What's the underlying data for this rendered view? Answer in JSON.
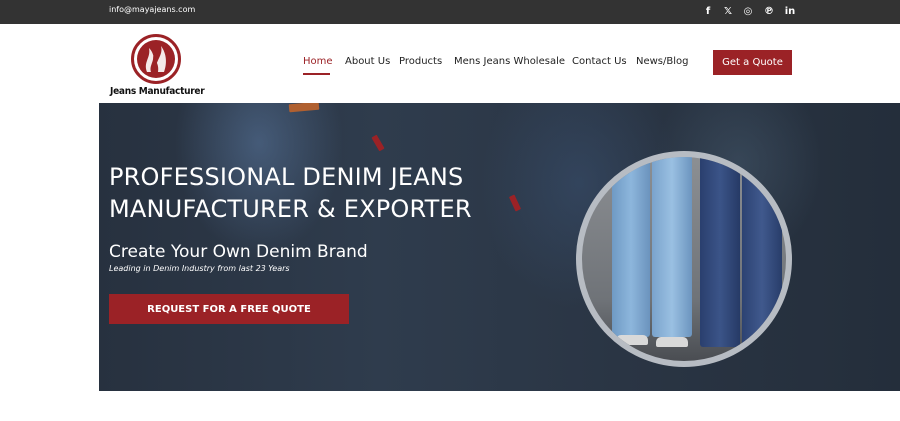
{
  "topbar": {
    "email": "info@mayajeans.com",
    "social": [
      {
        "icon": "facebook-icon",
        "glyph": "f"
      },
      {
        "icon": "x-icon",
        "glyph": "𝕏"
      },
      {
        "icon": "instagram-icon",
        "glyph": "◎"
      },
      {
        "icon": "pinterest-icon",
        "glyph": "℗"
      },
      {
        "icon": "linkedin-icon",
        "glyph": "in"
      }
    ]
  },
  "header": {
    "logo_text": "Jeans Manufacturer",
    "logo_glyph": "M",
    "nav": [
      {
        "label": "Home",
        "active": true
      },
      {
        "label": "About Us"
      },
      {
        "label": "Products"
      },
      {
        "label": "Mens Jeans Wholesale"
      },
      {
        "label": "Contact Us"
      },
      {
        "label": "News/Blog"
      }
    ],
    "cta": "Get a Quote"
  },
  "hero": {
    "title_line1": "PROFESSIONAL DENIM JEANS",
    "title_line2": "MANUFACTURER & EXPORTER",
    "subtitle": "Create Your Own Denim Brand",
    "tagline": "Leading in Denim Industry from last 23 Years",
    "button": "REQUEST FOR A FREE QUOTE"
  },
  "colors": {
    "brand_red": "#9b2226",
    "topbar": "#333333"
  }
}
